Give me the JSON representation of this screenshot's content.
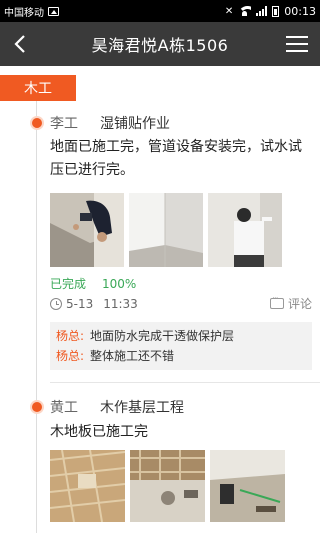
{
  "status_bar": {
    "carrier": "中国移动",
    "time": "00:13"
  },
  "header": {
    "title": "昊海君悦A栋1506"
  },
  "category": {
    "label": "木工"
  },
  "entries": [
    {
      "worker": "李工",
      "task": "湿铺贴作业",
      "description": "地面已施工完，管道设备安装完，试水试压已进行完。",
      "status": "已完成",
      "progress": "100%",
      "date": "5-13",
      "time": "11:33",
      "comment_label": "评论",
      "comments": [
        {
          "author": "杨总:",
          "text": "地面防水完成干透做保护层"
        },
        {
          "author": "杨总:",
          "text": "整体施工还不错"
        }
      ]
    },
    {
      "worker": "黄工",
      "task": "木作基层工程",
      "description": "木地板已施工完"
    }
  ],
  "colors": {
    "accent": "#f05a22",
    "titlebar": "#3a3a3a",
    "done": "#3aa857"
  }
}
